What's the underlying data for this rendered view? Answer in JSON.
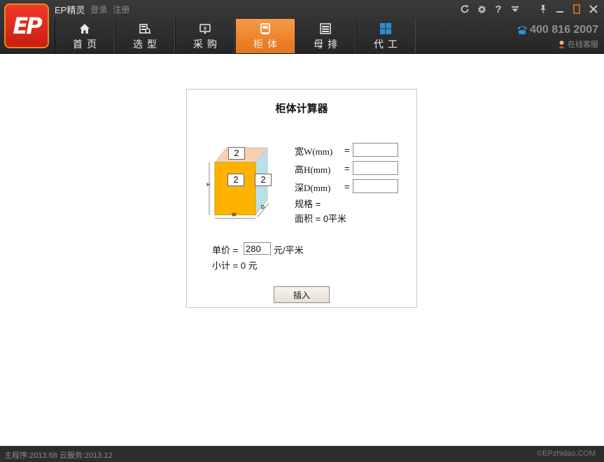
{
  "app": {
    "title": "EP精灵",
    "logo_text": "EP",
    "login_label": "登录",
    "register_label": "注册"
  },
  "window_controls": [
    {
      "icon": "refresh-icon",
      "glyph": "↻"
    },
    {
      "icon": "gear-icon",
      "glyph": "⚙"
    },
    {
      "icon": "help-icon",
      "glyph": "?"
    },
    {
      "icon": "dropdown-icon",
      "glyph": "⏷"
    },
    {
      "icon": "pin-icon",
      "glyph": "📌"
    },
    {
      "icon": "minimize-icon",
      "glyph": "—"
    },
    {
      "icon": "restore-icon",
      "glyph": "▯"
    },
    {
      "icon": "close-icon",
      "glyph": "✕"
    }
  ],
  "nav": {
    "tabs": [
      {
        "label": "首页",
        "icon": "home-icon"
      },
      {
        "label": "选型",
        "icon": "selection-icon"
      },
      {
        "label": "采购",
        "icon": "purchase-icon"
      },
      {
        "label": "柜体",
        "icon": "cabinet-icon",
        "active": true
      },
      {
        "label": "母排",
        "icon": "busbar-icon"
      },
      {
        "label": "代工",
        "icon": "oem-icon"
      }
    ]
  },
  "contact": {
    "phone": "400 816 2007",
    "online_service": "在线客服"
  },
  "calculator": {
    "title": "柜体计算器",
    "diagram": {
      "top_value": "2",
      "front_value": "2",
      "side_value": "2",
      "height_marker": "H",
      "width_marker": "W",
      "depth_marker": "D"
    },
    "width_label": "宽W(mm)",
    "height_label": "高H(mm)",
    "depth_label": "深D(mm)",
    "equals": "=",
    "width_value": "",
    "height_value": "",
    "depth_value": "",
    "spec_line": "规格 =",
    "area_line": "面积 = 0平米",
    "unit_price_label": "单价 =",
    "unit_price_value": "280",
    "unit_price_unit": "元/平米",
    "subtotal_line": "小计 = 0 元",
    "insert_button": "插入"
  },
  "status": {
    "version": "主程序:2013.68  云服务:2013.12",
    "copyright": "©EPzhidao.COM"
  },
  "colors": {
    "active_tab": "#f0812c",
    "box_front": "#ffb300",
    "box_top": "#f9cfb2",
    "box_side": "#b9dfe8"
  }
}
